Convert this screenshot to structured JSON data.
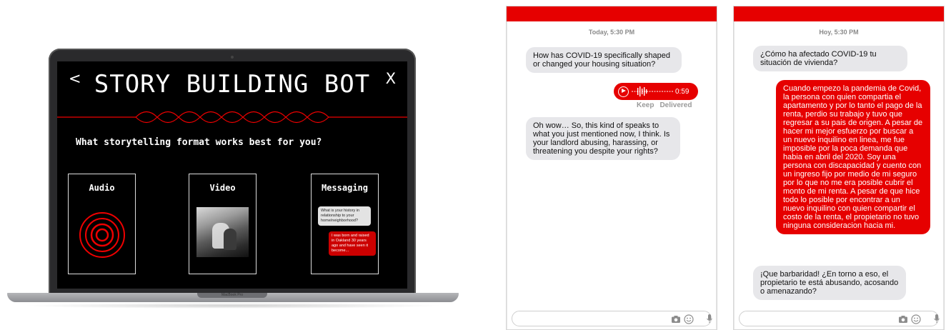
{
  "laptop": {
    "back_label": "<",
    "close_label": "X",
    "title": "STORY BUILDING BOT",
    "question": "What storytelling format works best for you?",
    "cards": [
      {
        "label": "Audio"
      },
      {
        "label": "Video"
      },
      {
        "label": "Messaging"
      }
    ],
    "messaging_preview": {
      "question": "What is your history in relationship to your home/neighborhood?",
      "answer": "I was born and raised in Oakland 30 years ago and have seen it become..."
    },
    "brand_text": "MacBook Pro"
  },
  "phone_en": {
    "timestamp": "Today, 5:30 PM",
    "message_1": "How has COVID-19 specifically shaped or changed your housing situation?",
    "audio_duration": "0:59",
    "keep_label": "Keep",
    "delivered_label": "Delivered",
    "message_2": "Oh wow… So, this kind of speaks to what you just mentioned now, I think. Is your landlord abusing, harassing, or threatening you despite your rights?",
    "input_value": ""
  },
  "phone_es": {
    "timestamp": "Hoy, 5:30 PM",
    "message_1": "¿Cómo ha afectado COVID-19 tu situación de vivienda?",
    "message_2": "Cuando empezo la pandemia de Covid, la persona con quien compartia el apartamento y por lo tanto el pago de la renta, perdio su trabajo y tuvo que regresar a su pais de origen.  A pesar de hacer mi mejor esfuerzo por buscar a un nuevo inquilino en linea, me fue imposible por la poca demanda que habia en abril del 2020.  Soy una persona con discapacidad y cuento con un ingreso fijo por medio de mi seguro por lo que no me era posible cubrir el monto de mi renta.  A pesar de que hice todo lo posible por encontrar a un nuevo inquilino con quien compartir el costo de la renta, el propietario no tuvo ninguna consideracion hacia mi.",
    "message_3": "¡Que barbaridad! ¿En torno a eso, el propietario te está abusando, acosando o amenazando?",
    "input_value": ""
  },
  "colors": {
    "accent_red": "#e60000",
    "screen_bg": "#000000",
    "bubble_gray": "#e7e7ea"
  },
  "icons": [
    "camera-icon",
    "emoji-icon",
    "microphone-icon",
    "play-icon"
  ]
}
